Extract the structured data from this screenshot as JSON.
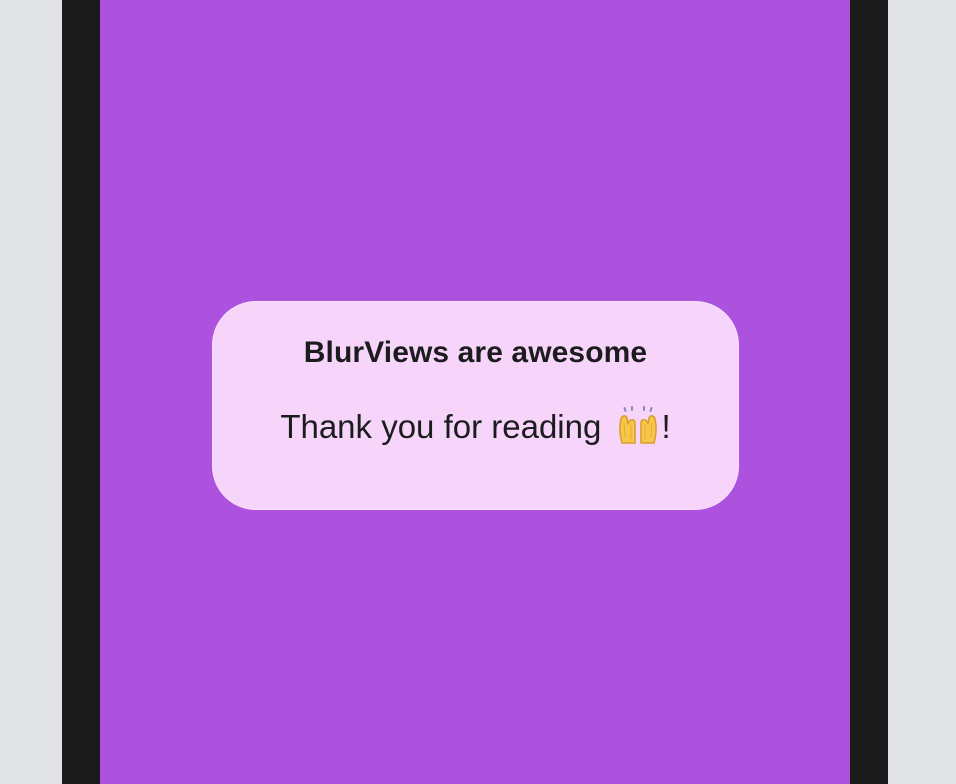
{
  "colors": {
    "outer_background": "#e1e3e7",
    "device_frame": "#1b1b1b",
    "screen_background": "#ad52de",
    "card_background": "#f7d5fb",
    "text": "#1c1c1e",
    "emoji_yellow": "#f7c64a"
  },
  "card": {
    "title": "BlurViews are awesome",
    "subtitle_text": "Thank you for reading",
    "subtitle_suffix": "!",
    "emoji_icon": "raising-hands-emoji"
  }
}
